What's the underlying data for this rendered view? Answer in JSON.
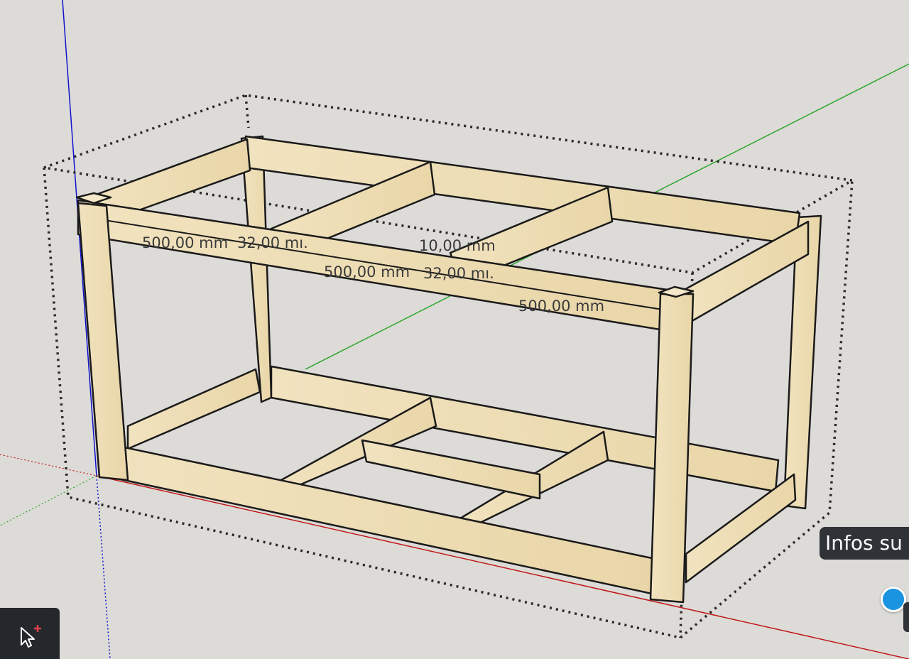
{
  "viewport": {
    "dimension_labels": [
      {
        "id": "dim-1",
        "text": "500,00 mm"
      },
      {
        "id": "dim-2",
        "text": "32,00 mı."
      },
      {
        "id": "dim-3",
        "text": "10,00 mm"
      },
      {
        "id": "dim-4",
        "text": "500,00 mm"
      },
      {
        "id": "dim-5",
        "text": "32,00 mı."
      },
      {
        "id": "dim-6",
        "text": "500,00 mm"
      }
    ]
  },
  "tooltip": {
    "text": "Infos su"
  },
  "toolbar": {
    "active_tool_icon": "select-add-icon"
  },
  "colors": {
    "background": "#dddbd7",
    "wood": "#ecdcb4",
    "axis_x": "#c0191b",
    "axis_y": "#2aa52a",
    "axis_z": "#1111cc",
    "selection_accent": "#1a94e0"
  }
}
